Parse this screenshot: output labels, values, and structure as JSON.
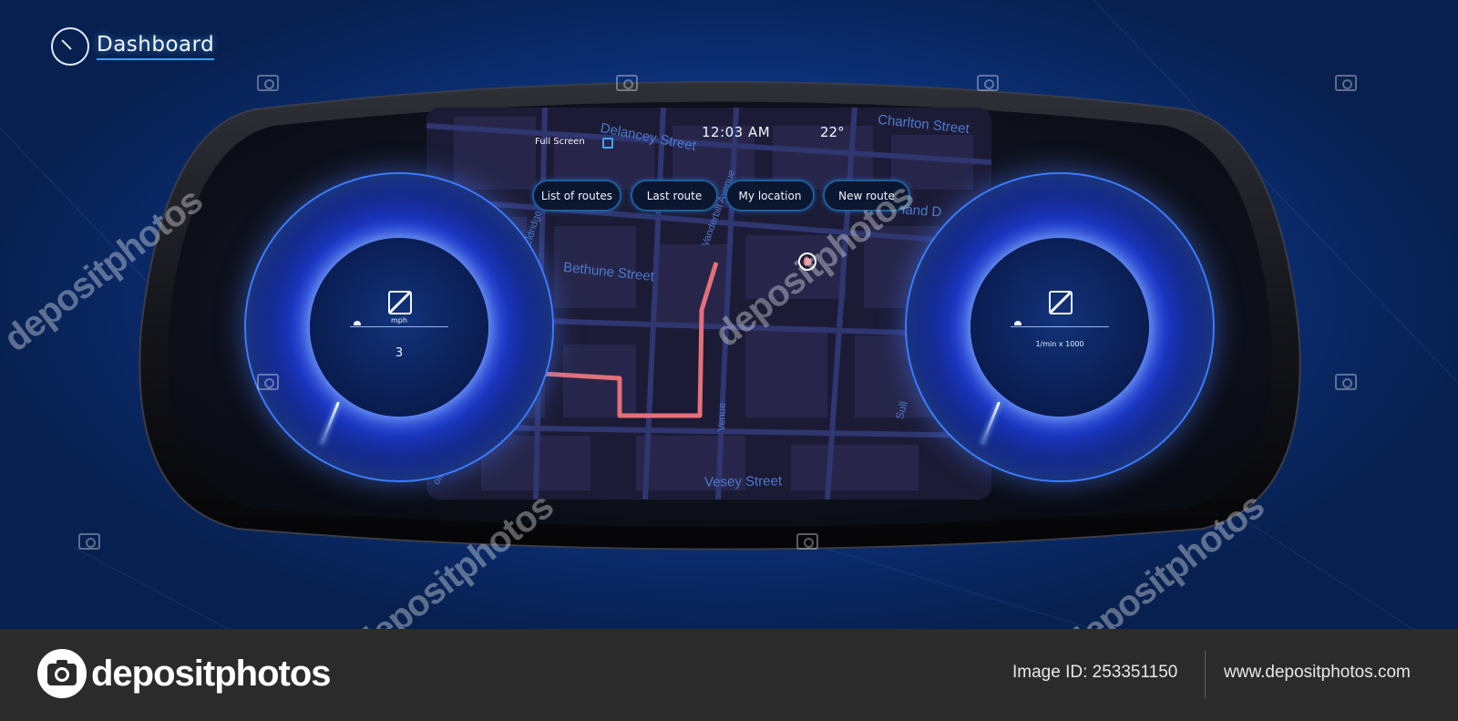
{
  "header": {
    "title": "Dashboard",
    "icon": "speedometer-icon"
  },
  "map": {
    "streets": {
      "delancey": "Delancey Street",
      "charlton": "Charlton Street",
      "bethune": "Bethune Street",
      "vesey": "Vesey Street",
      "vanderbilt": "Vanderbilt Avenue",
      "eldridge": "Eldridge",
      "venue": "Venue",
      "island": "land D",
      "sull": "Sull",
      "olf": "olf Avenue"
    },
    "route_color": "#e4707a"
  },
  "status": {
    "fullscreen_label": "Full Screen",
    "time": "12:03 AM",
    "temperature": "22°"
  },
  "nav_buttons": {
    "list_of_routes": "List of routes",
    "last_route": "Last route",
    "my_location": "My location",
    "new_route": "New route"
  },
  "speed_gauge": {
    "unit": "mph",
    "value": "3"
  },
  "rpm_gauge": {
    "unit": "1/min x 1000"
  },
  "watermark": "depositphotos",
  "footer": {
    "brand": "depositphotos",
    "image_id": "Image ID: 253351150",
    "url": "www.depositphotos.com"
  },
  "colors": {
    "accent": "#3aa0ff",
    "background": "#0f3a8e",
    "route": "#e4707a"
  }
}
